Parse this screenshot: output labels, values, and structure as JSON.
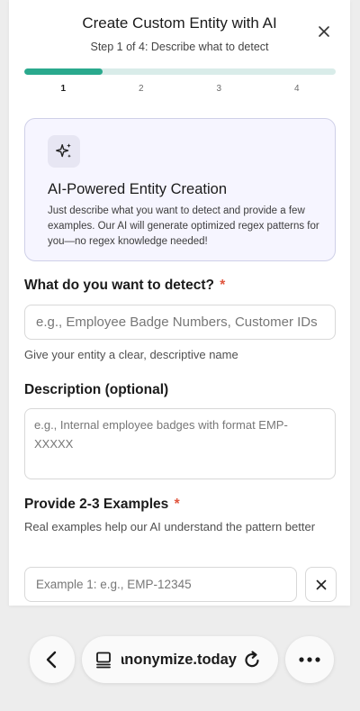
{
  "modal": {
    "title": "Create Custom Entity with AI",
    "subtitle": "Step 1 of 4: Describe what to detect",
    "progress_fraction": 0.25,
    "steps": [
      "1",
      "2",
      "3",
      "4"
    ],
    "active_step": "1",
    "close_icon": "close-icon"
  },
  "info_card": {
    "icon": "sparkles-icon",
    "title": "AI-Powered Entity Creation",
    "body": "Just describe what you want to detect and provide a few examples. Our AI will generate optimized regex patterns for you—no regex knowledge needed!"
  },
  "form": {
    "name": {
      "label": "What do you want to detect?",
      "required_mark": "*",
      "placeholder": "e.g., Employee Badge Numbers, Customer IDs",
      "value": "",
      "hint": "Give your entity a clear, descriptive name"
    },
    "description": {
      "label": "Description (optional)",
      "placeholder": "e.g., Internal employee badges with format EMP-XXXXX",
      "value": ""
    },
    "examples": {
      "label": "Provide 2-3 Examples",
      "required_mark": "*",
      "hint": "Real examples help our AI understand the pattern better",
      "items": [
        {
          "placeholder": "Example 1: e.g., EMP-12345",
          "value": ""
        }
      ]
    }
  },
  "colors": {
    "accent": "#2aa98d",
    "progress_track": "#d9ece9",
    "card_background": "#f6f5ff",
    "card_border": "#cfd0e8",
    "required": "#e0563f"
  },
  "browser": {
    "url": "anonymize.today",
    "back_icon": "back-arrow-icon",
    "tab_icon": "tab-overview-icon",
    "reload_icon": "reload-icon",
    "more_icon": "more-options-icon"
  }
}
